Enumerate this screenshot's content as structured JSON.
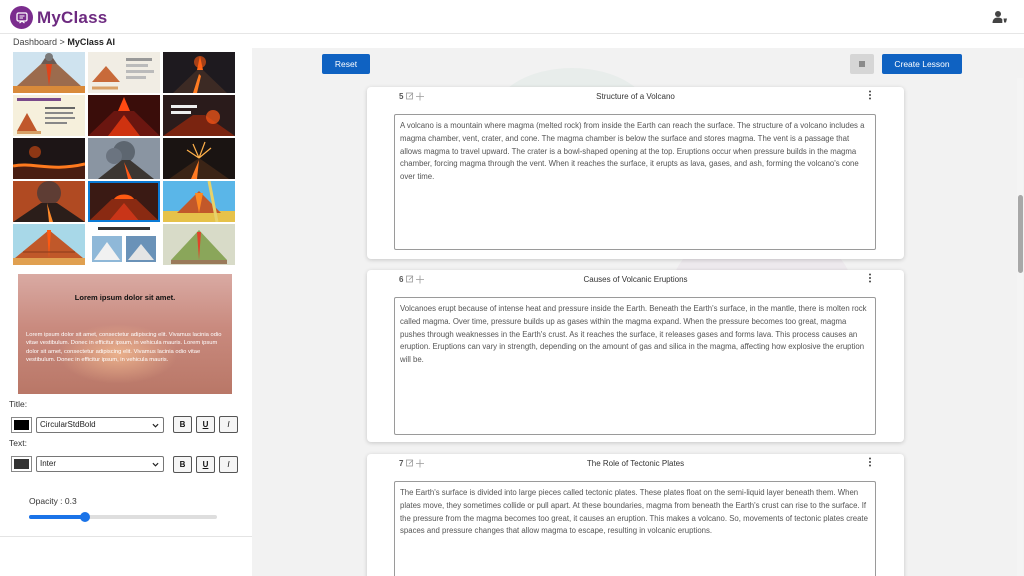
{
  "app": {
    "name": "MyClass"
  },
  "breadcrumb": {
    "root": "Dashboard",
    "separator": ">",
    "current": "MyClass AI"
  },
  "thumbnails": [
    {
      "name": "thumb-1",
      "selected": false
    },
    {
      "name": "thumb-2",
      "selected": false
    },
    {
      "name": "thumb-3",
      "selected": false
    },
    {
      "name": "thumb-4",
      "selected": false
    },
    {
      "name": "thumb-5",
      "selected": false
    },
    {
      "name": "thumb-6",
      "selected": false
    },
    {
      "name": "thumb-7",
      "selected": false
    },
    {
      "name": "thumb-8",
      "selected": false
    },
    {
      "name": "thumb-9",
      "selected": false
    },
    {
      "name": "thumb-10",
      "selected": false
    },
    {
      "name": "thumb-11",
      "selected": true
    },
    {
      "name": "thumb-12",
      "selected": false
    },
    {
      "name": "thumb-13",
      "selected": false
    },
    {
      "name": "thumb-14",
      "selected": false
    },
    {
      "name": "thumb-15",
      "selected": false
    }
  ],
  "preview": {
    "title": "Lorem ipsum dolor sit amet.",
    "body": "Lorem ipsum dolor sit amet, consectetur adipiscing elit. Vivamus lacinia odio vitae vestibulum. Donec in efficitur ipsum, in vehicula mauris. Lorem ipsum dolor sit amet, consectetur adipiscing elit. Vivamus lacinia odio vitae vestibulum. Donec in efficitur ipsum, in vehicula mauris."
  },
  "style_panel": {
    "title_label": "Title:",
    "title_font": "CircularStdBold",
    "title_color": "#000000",
    "text_label": "Text:",
    "text_font": "Inter",
    "text_color": "#333333",
    "bold_label": "B",
    "underline_label": "U",
    "italic_label": "I",
    "opacity_label": "Opacity : 0.3",
    "opacity_value": 0.3
  },
  "toolbar": {
    "reset_label": "Reset",
    "create_label": "Create Lesson"
  },
  "colors": {
    "brand": "#6d2a80",
    "primary": "#0f62c2",
    "slider": "#1a73e8"
  },
  "cards": [
    {
      "number": "5",
      "title": "Structure of a Volcano",
      "text": "A volcano is a mountain where magma (melted rock) from inside the Earth can reach the surface. The structure of a volcano includes a magma chamber, vent, crater, and cone. The magma chamber is below the surface and stores magma. The vent is a passage that allows magma to travel upward. The crater is a bowl-shaped opening at the top. Eruptions occur when pressure builds in the magma chamber, forcing magma through the vent. When it reaches the surface, it erupts as lava, gases, and ash, forming the volcano's cone over time."
    },
    {
      "number": "6",
      "title": "Causes of Volcanic Eruptions",
      "text": "Volcanoes erupt because of intense heat and pressure inside the Earth. Beneath the Earth's surface, in the mantle, there is molten rock called magma. Over time, pressure builds up as gases within the magma expand. When the pressure becomes too great, magma pushes through weaknesses in the Earth's crust. As it reaches the surface, it releases gases and forms lava. This process causes an eruption. Eruptions can vary in strength, depending on the amount of gas and silica in the magma, affecting how explosive the eruption will be."
    },
    {
      "number": "7",
      "title": "The Role of Tectonic Plates",
      "text": "The Earth's surface is divided into large pieces called tectonic plates. These plates float on the semi-liquid layer beneath them. When plates move, they sometimes collide or pull apart. At these boundaries, magma from beneath the Earth's crust can rise to the surface. If the pressure from the magma becomes too great, it causes an eruption. This makes a volcano. So, movements of tectonic plates create spaces and pressure changes that allow magma to escape, resulting in volcanic eruptions."
    }
  ]
}
